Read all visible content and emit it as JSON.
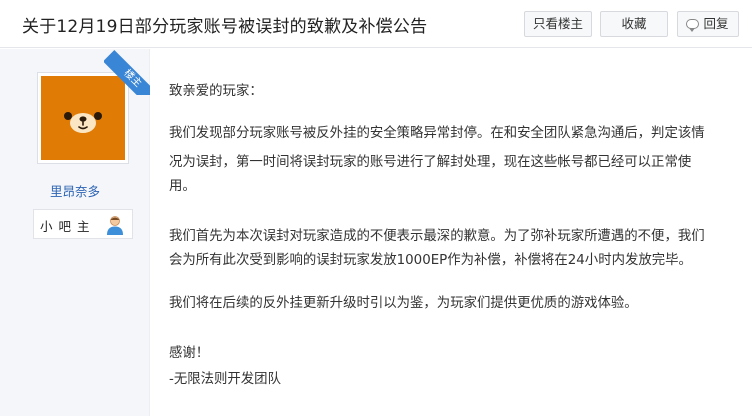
{
  "thread": {
    "title": "关于12月19日部分玩家账号被误封的致歉及补偿公告",
    "buttons": {
      "only_lz": "只看楼主",
      "favorite": "收藏",
      "reply": "回复"
    }
  },
  "author": {
    "ribbon": "楼主",
    "name": "里昂奈多",
    "badge": "小吧主",
    "avatar": "rilakkuma-bear-avatar",
    "badge_icon": "user-person-icon"
  },
  "colors": {
    "avatar_bg": "#e07b06",
    "ribbon": "#3a86d6",
    "link": "#2d64b3"
  },
  "post": {
    "lines": [
      "致亲爱的玩家：",
      "我们发现部分玩家账号被反外挂的安全策略异常封停。在和安全团队紧急沟通后，判定该情",
      "况为误封，第一时间将误封玩家的账号进行了解封处理，现在这些帐号都已经可以正常使",
      "用。",
      "我们首先为本次误封对玩家造成的不便表示最深的歉意。为了弥补玩家所遭遇的不便，我们",
      "会为所有此次受到影响的误封玩家发放1000EP作为补偿，补偿将在24小时内发放完毕。",
      "我们将在后续的反外挂更新升级时引以为鉴，为玩家们提供更优质的游戏体验。",
      "感谢！",
      "-无限法则开发团队"
    ]
  }
}
